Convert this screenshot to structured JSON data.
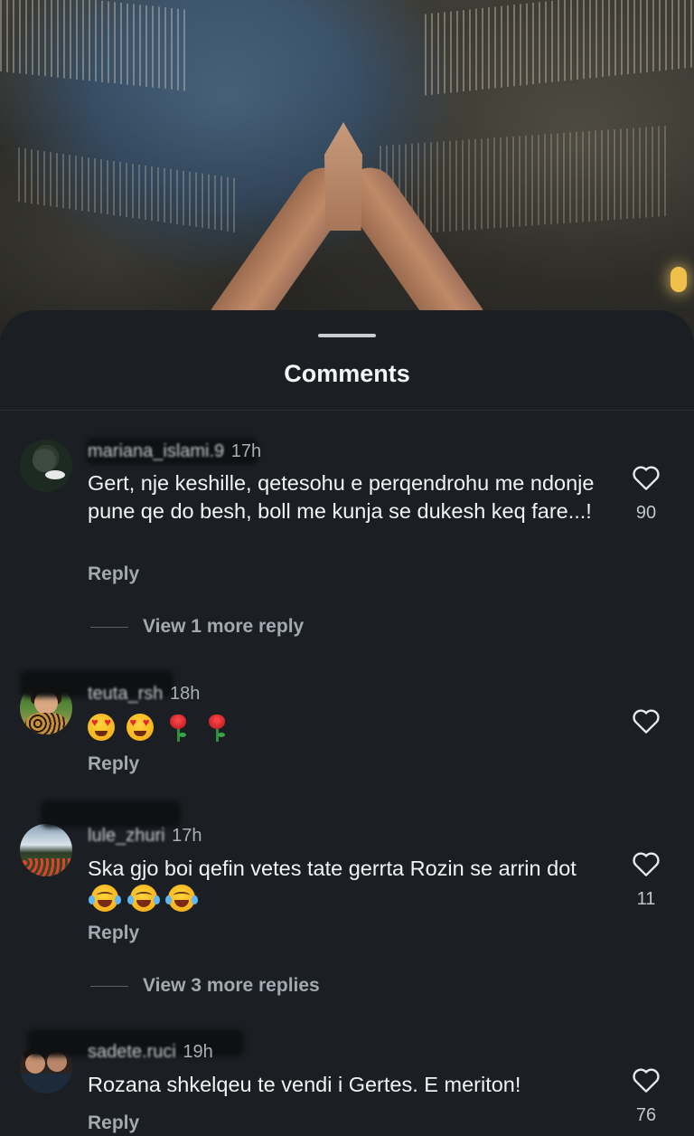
{
  "sheet": {
    "title": "Comments"
  },
  "comments": [
    {
      "username": "mariana_islami.9",
      "time": "17h",
      "text": "Gert, nje keshille, qetesohu e perqendrohu me ndonje pune qe do besh, boll me kunja  se dukesh keq fare...!",
      "reply_label": "Reply",
      "view_more": "View 1 more reply",
      "likes": "90"
    },
    {
      "username": "teuta_rsh",
      "time": "18h",
      "emojis": [
        "heart-eyes",
        "heart-eyes",
        "rose",
        "rose"
      ],
      "reply_label": "Reply",
      "likes": ""
    },
    {
      "username": "lule_zhuri",
      "time": "17h",
      "text": "Ska gjo boi qefin vetes tate  gerrta Rozin se arrin dot",
      "emojis": [
        "laughing-tears",
        "laughing-tears",
        "laughing-tears"
      ],
      "reply_label": "Reply",
      "view_more": "View 3 more replies",
      "likes": "11"
    },
    {
      "username": "sadete.ruci",
      "time": "19h",
      "text": "Rozana shkelqeu te vendi i Gertes. E meriton!",
      "reply_label": "Reply",
      "likes": "76"
    }
  ],
  "icons": {
    "like": "heart-outline-icon"
  },
  "colors": {
    "sheet_bg": "#1b1f24",
    "text": "#f1f3f5",
    "muted": "#a3a9b0"
  }
}
